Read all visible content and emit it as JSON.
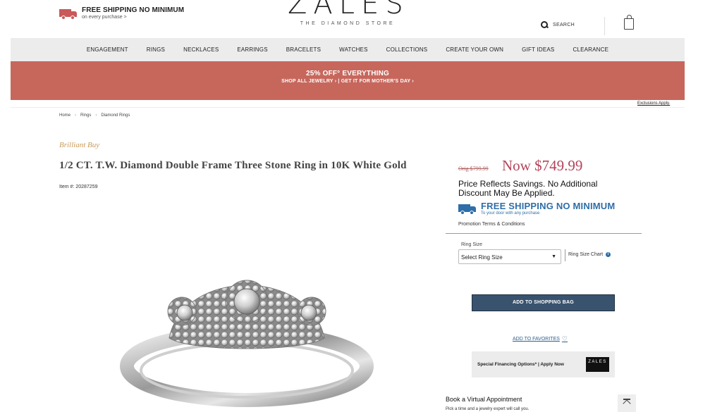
{
  "header": {
    "shipping_title": "FREE SHIPPING NO MINIMUM",
    "shipping_sub": "on every purchase >",
    "logo_word": "ZALES",
    "logo_tagline": "THE DIAMOND STORE",
    "search_label": "SEARCH"
  },
  "nav": {
    "items": [
      "ENGAGEMENT",
      "RINGS",
      "NECKLACES",
      "EARRINGS",
      "BRACELETS",
      "WATCHES",
      "COLLECTIONS",
      "CREATE YOUR OWN",
      "GIFT IDEAS",
      "CLEARANCE"
    ]
  },
  "promo": {
    "title": "25% OFF° EVERYTHING",
    "subtitle": "SHOP ALL JEWELRY ›  |  GET IT FOR MOTHER'S DAY ›",
    "exclusions": "Exclusions Apply."
  },
  "breadcrumb": {
    "items": [
      "Home",
      "Rings",
      "Diamond Rings"
    ],
    "separator": "›"
  },
  "product": {
    "brand": "Brilliant Buy",
    "title": "1/2 CT. T.W. Diamond Double Frame Three Stone Ring in 10K White Gold",
    "item_number": "Item #: 20287259"
  },
  "pricing": {
    "orig": "Orig $799.99",
    "now": "Now $749.99",
    "savings_note": "Price Reflects Savings. No Additional Discount May Be Applied.",
    "free_shipping_title": "FREE SHIPPING NO MINIMUM",
    "free_shipping_sub": "To your door with any purchase",
    "promo_terms": "Promotion Terms & Conditions"
  },
  "ring_size": {
    "label": "Ring Size",
    "selected": "Select Ring Size",
    "chart_link": "Ring Size Chart"
  },
  "actions": {
    "add_to_bag": "ADD TO SHOPPING BAG",
    "add_to_favorites": "ADD TO FAVORITES",
    "financing": "Special Financing Options* | Apply Now",
    "financing_logo": "ZALES"
  },
  "appointment": {
    "title": "Book a Virtual Appointment",
    "subtitle": "Pick a time and a jewelry expert will call you."
  },
  "colors": {
    "promo_bg": "#c7675c",
    "price_now": "#b3445a",
    "brand_gold": "#c79a5c",
    "ship_blue": "#2f6ea7",
    "add_bag_bg": "#39536f"
  },
  "icons": {
    "truck": "truck-icon",
    "search": "search-icon",
    "bag": "shopping-bag-icon",
    "info": "info-icon",
    "heart": "heart-icon",
    "back_to_top": "back-to-top-icon"
  }
}
